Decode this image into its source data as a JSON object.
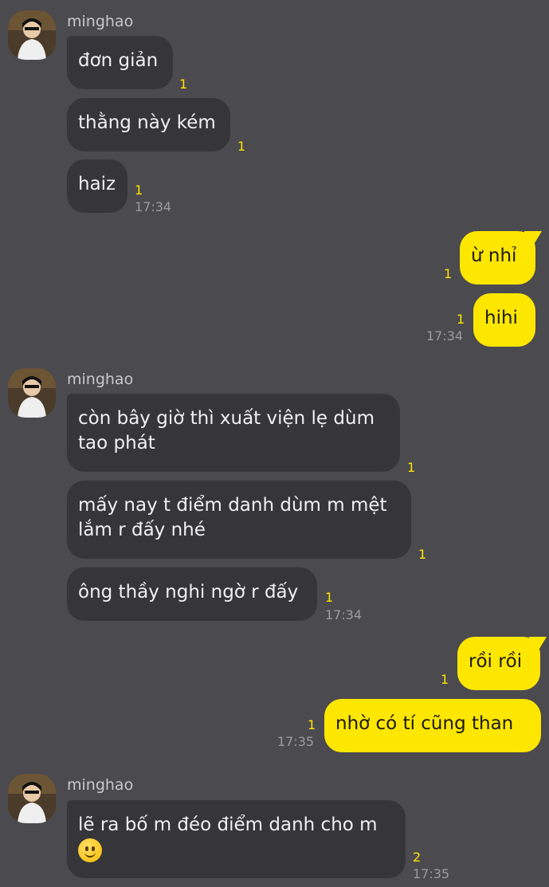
{
  "groups": [
    {
      "sender": "minghao",
      "messages": [
        {
          "text": "đơn giản",
          "count": "1"
        },
        {
          "text": "thằng này kém",
          "count": "1"
        },
        {
          "text": "haiz",
          "count": "1"
        }
      ],
      "time": "17:34"
    },
    {
      "sender": "me",
      "messages": [
        {
          "text": "ừ nhỉ",
          "count": "1"
        },
        {
          "text": "hihi",
          "count": "1"
        }
      ],
      "time": "17:34"
    },
    {
      "sender": "minghao",
      "messages": [
        {
          "text": "còn bây giờ thì xuất viện lẹ dùm\ntao phát",
          "count": "1"
        },
        {
          "text": "mấy nay t điểm danh dùm m mệt\nlắm r đấy nhé",
          "count": "1"
        },
        {
          "text": "ông thầy nghi ngờ r đấy",
          "count": "1"
        }
      ],
      "time": "17:34"
    },
    {
      "sender": "me",
      "messages": [
        {
          "text": "rồi rồi",
          "count": "1"
        },
        {
          "text": "nhờ có tí cũng than",
          "count": "1"
        }
      ],
      "time": "17:35"
    },
    {
      "sender": "minghao",
      "messages": [
        {
          "text": "lẽ ra bố m đéo điểm danh cho m",
          "emoji": "slightly-smiling-face",
          "count": "2"
        }
      ],
      "time": "17:35"
    }
  ],
  "colors": {
    "background": "#4b4a4f",
    "incoming_bubble": "#363539",
    "outgoing_bubble": "#fde600",
    "unread_count": "#fde600"
  }
}
